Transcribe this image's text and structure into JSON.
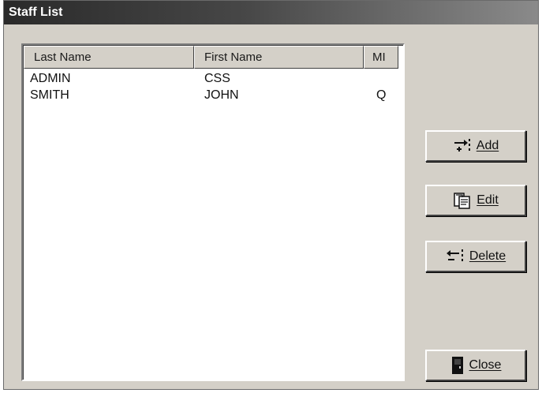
{
  "window": {
    "title": "Staff List"
  },
  "list": {
    "columns": [
      "Last Name",
      "First Name",
      "MI"
    ],
    "rows": [
      {
        "last": "ADMIN",
        "first": "CSS",
        "mi": ""
      },
      {
        "last": "SMITH",
        "first": "JOHN",
        "mi": "Q"
      }
    ]
  },
  "buttons": {
    "add": {
      "label": "Add",
      "icon": "add-row-icon"
    },
    "edit": {
      "label": "Edit",
      "icon": "edit-document-icon"
    },
    "delete": {
      "label": "Delete",
      "icon": "delete-row-icon"
    },
    "close": {
      "label": "Close",
      "icon": "door-icon"
    }
  }
}
